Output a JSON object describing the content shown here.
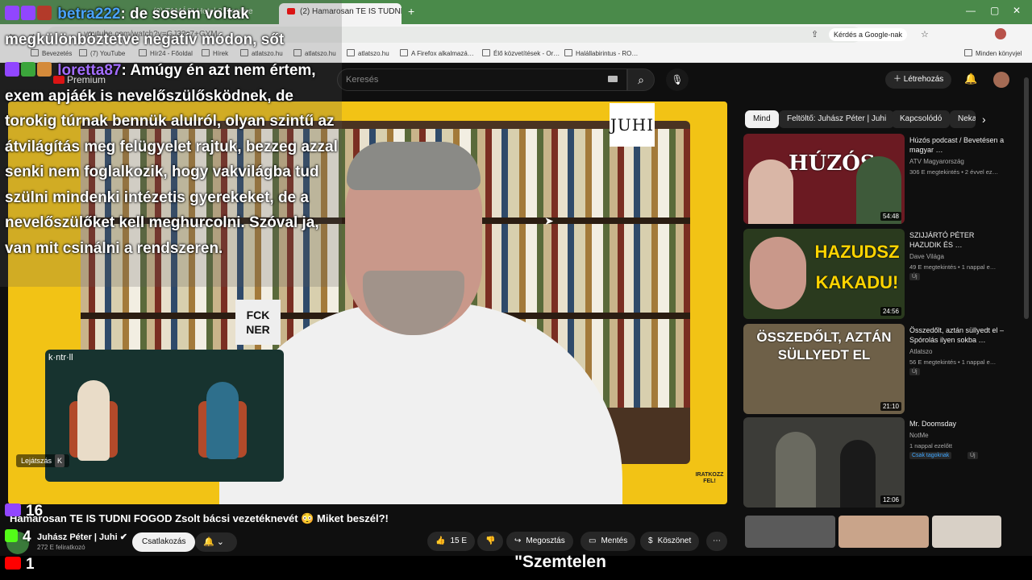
{
  "browser": {
    "tabs": [
      {
        "label": "(2) TAMÁSI Hotel 2.0 online"
      },
      {
        "label": "(2) Hamarosan TE IS TUDNI FO…"
      }
    ],
    "url": "youtube.com/watch?v=GJ32c7+GYM",
    "ask_google": "Kérdés a Google-nak",
    "bookmarks": [
      "Bevezetés",
      "(7) YouTube",
      "Hír24 - Főoldal",
      "Hírek",
      "atlatszo.hu",
      "atlatszo.hu",
      "atlatszo.hu",
      "A Firefox alkalmazá…",
      "Élő közvetítések - Or…",
      "Halállabirintus - RO…",
      "Minden könyvjel"
    ]
  },
  "youtube": {
    "logo": "Premium",
    "search_placeholder": "Keresés",
    "create_label": "Létrehozás"
  },
  "video": {
    "juhi_logo": "JUHI",
    "fck_sign": "FCK NER",
    "pip_brand": "k·ntr·ll",
    "skip_label": "Lejátszás",
    "skip_key": "K",
    "corner_text": "IRATKOZZ FEL!",
    "title": "Hamarosan TE IS TUDNI FOGOD Zsolt bácsi vezetéknevét 😳 Miket beszél?!",
    "channel": "Juhász Péter | Juhi",
    "subscribers": "272 E feliratkozó",
    "join_label": "Csatlakozás",
    "likes": "15 E",
    "share_label": "Megosztás",
    "save_label": "Mentés",
    "thanks_label": "Köszönet"
  },
  "chat": [
    {
      "user": "betra222",
      "text": ": de sosem voltak megkülönböztetve negatív módon, sőt"
    },
    {
      "user": "loretta87",
      "text": ": Amúgy én azt nem értem, exem apjáék is nevelőszülősködnek, de torokig túrnak bennük alulról, olyan szintű az átvilágítás meg felügyelet rajtuk, bezzeg azzal senki nem foglalkozik, hogy vakvilágba tud szülni mindenki intézetis gyerekeket, de a nevelőszülőket kell meghurcolni. Szóval ja, van mit csinálni a rendszeren."
    }
  ],
  "overlay": {
    "twitch_viewers": "16",
    "kick_viewers": "4",
    "youtube_viewers": "1",
    "caption": "\"Szemtelen"
  },
  "sidebar": {
    "chips": [
      "Mind",
      "Feltöltő: Juhász Péter | Juhi",
      "Kapcsolódó",
      "Neka"
    ],
    "recs": [
      {
        "title": "Húzós podcast / Bevetésen a magyar …",
        "channel": "ATV Magyarország",
        "meta": "306 E megtekintés • 2 évvel ez…",
        "duration": "54:48",
        "thumb_text": "HÚZÓS",
        "badge": ""
      },
      {
        "title": "SZIJJÁRTÓ PÉTER HAZUDIK ÉS …",
        "channel": "Dave Világa",
        "meta": "49 E megtekintés • 1 nappal e…",
        "duration": "24:56",
        "thumb_text": "HAZUDSZ KAKADU!",
        "badge": "Új"
      },
      {
        "title": "Összedőlt, aztán süllyedt el – Spórolás ilyen sokba …",
        "channel": "Atlatszo",
        "meta": "56 E megtekintés • 1 nappal e…",
        "duration": "21:10",
        "thumb_text": "ÖSSZEDŐLT, AZTÁN SÜLLYEDT EL",
        "badge": "Új"
      },
      {
        "title": "Mr. Doomsday",
        "channel": "NotMe",
        "meta": "1 nappal ezelőtt",
        "duration": "12:06",
        "thumb_text": "",
        "badge": "Csak tagoknak",
        "badge2": "Új"
      }
    ]
  },
  "colors": {
    "youtube_red": "#ff0000",
    "player_yellow": "#f2c315",
    "twitch_purple": "#9146ff",
    "tab_green": "#4a8a4a"
  }
}
